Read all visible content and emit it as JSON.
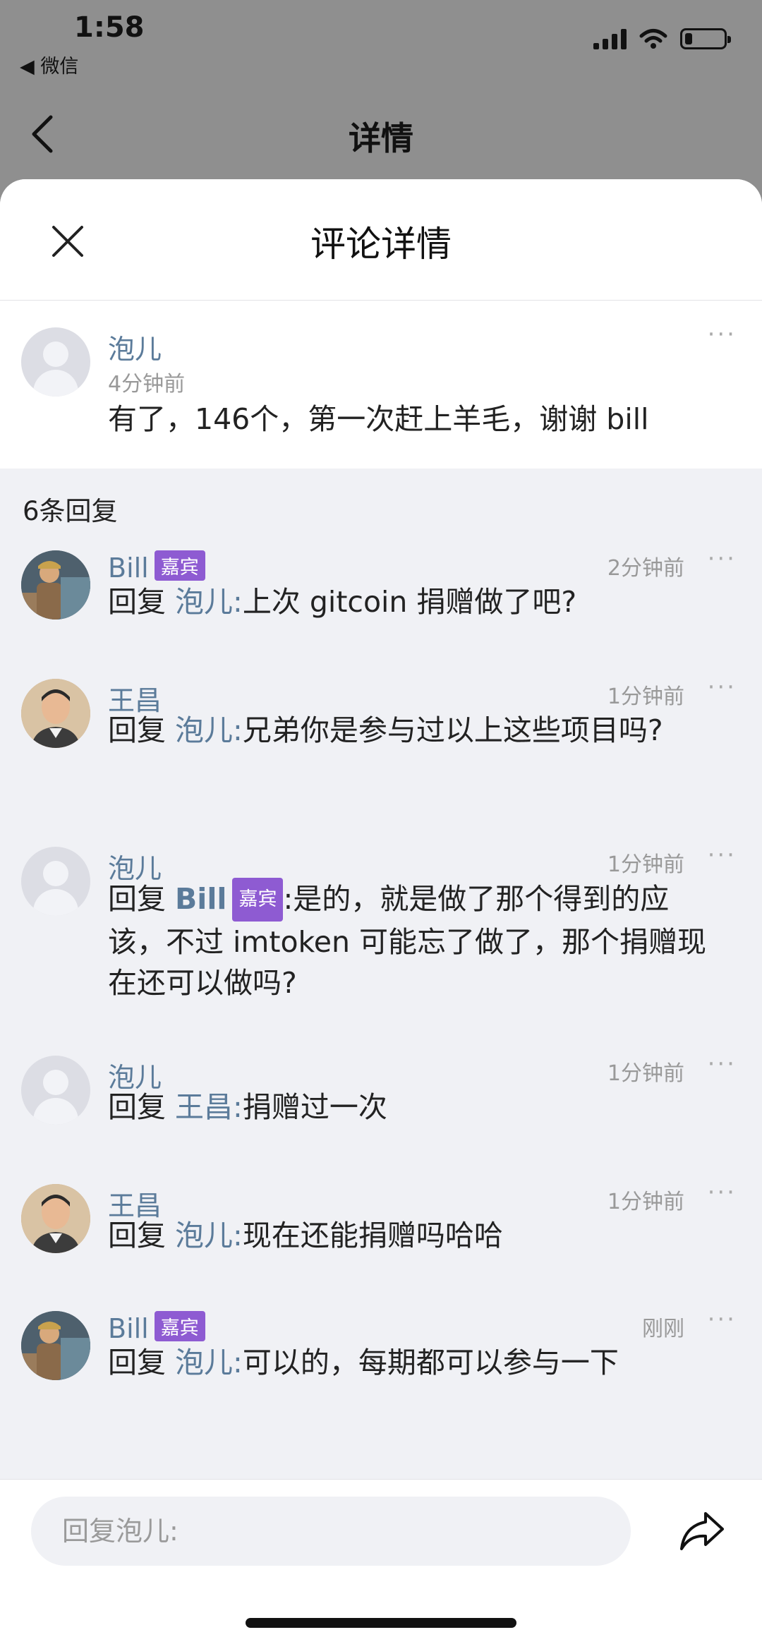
{
  "status_bar": {
    "time": "1:58",
    "back_app": "◀ 微信",
    "battery_level": 0.2
  },
  "underlying_page": {
    "title": "详情"
  },
  "sheet": {
    "title": "评论详情"
  },
  "main_comment": {
    "name": "泡儿",
    "time": "4分钟前",
    "content": "有了，146个，第一次赶上羊毛，谢谢 bill",
    "more": "···"
  },
  "reply_count": "6条回复",
  "guest_badge": "嘉宾",
  "reply_prefix": "回复",
  "replies": [
    {
      "name": "Bill",
      "is_guest": true,
      "time": "2分钟前",
      "mention": "泡儿:",
      "text": "上次 gitcoin 捐赠做了吧?",
      "more": "···"
    },
    {
      "name": "王昌",
      "is_guest": false,
      "time": "1分钟前",
      "mention": "泡儿:",
      "text": "兄弟你是参与过以上这些项目吗?",
      "more": "···"
    },
    {
      "name": "泡儿",
      "is_guest": false,
      "time": "1分钟前",
      "mention": "Bill",
      "mention_guest": true,
      "text": ":是的，就是做了那个得到的应该，不过 imtoken 可能忘了做了，那个捐赠现在还可以做吗?",
      "more": "···"
    },
    {
      "name": "泡儿",
      "is_guest": false,
      "time": "1分钟前",
      "mention": "王昌:",
      "text": "捐赠过一次",
      "more": "···"
    },
    {
      "name": "王昌",
      "is_guest": false,
      "time": "1分钟前",
      "mention": "泡儿:",
      "text": "现在还能捐赠吗哈哈",
      "more": "···"
    },
    {
      "name": "Bill",
      "is_guest": true,
      "time": "刚刚",
      "mention": "泡儿:",
      "text": "可以的，每期都可以参与一下",
      "more": "···"
    }
  ],
  "input": {
    "placeholder": "回复泡儿:"
  },
  "icons": {
    "back": "chevron-left-icon",
    "close": "close-icon",
    "share": "share-arrow-icon",
    "more": "more-dots-icon"
  },
  "colors": {
    "name": "#5b7b9a",
    "guest_badge": "#8e5bd2",
    "sheet_bg": "#f0f1f5",
    "overlay": "#8f8f8f"
  }
}
